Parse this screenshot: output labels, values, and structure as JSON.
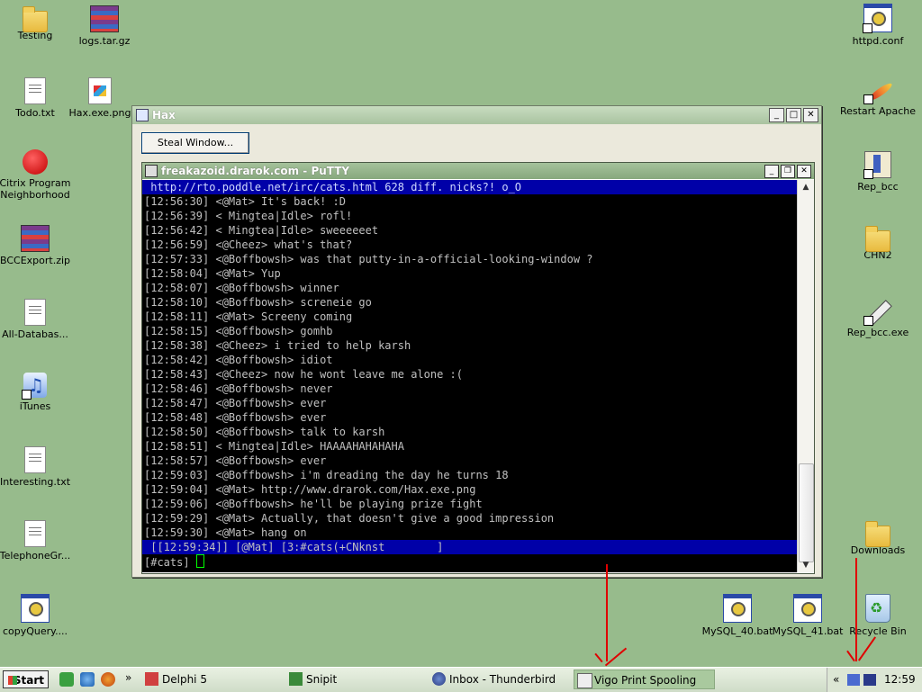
{
  "desktop": {
    "left_icons": [
      {
        "label": "Testing",
        "type": "folder"
      },
      {
        "label": "logs.tar.gz",
        "type": "rar"
      },
      {
        "label": "Todo.txt",
        "type": "doc"
      },
      {
        "label": "Hax.exe.png",
        "type": "png"
      },
      {
        "label": "Citrix Program Neighborhood",
        "type": "citrix"
      },
      {
        "label": "BCCExport.zip",
        "type": "rar"
      },
      {
        "label": "All-Databas...",
        "type": "doc"
      },
      {
        "label": "iTunes",
        "type": "itunes"
      },
      {
        "label": "Interesting.txt",
        "type": "doc"
      },
      {
        "label": "TelephoneGr...",
        "type": "doc"
      },
      {
        "label": "copyQuery....",
        "type": "win"
      }
    ],
    "right_icons": [
      {
        "label": "httpd.conf",
        "type": "win"
      },
      {
        "label": "Restart Apache",
        "type": "feather"
      },
      {
        "label": "Rep_bcc",
        "type": "bcc"
      },
      {
        "label": "CHN2",
        "type": "folder"
      },
      {
        "label": "Rep_bcc.exe",
        "type": "wrench"
      },
      {
        "label": "Downloads",
        "type": "folder"
      },
      {
        "label": "MySQL_40.bat",
        "type": "win"
      },
      {
        "label": "MySQL_41.bat",
        "type": "win"
      },
      {
        "label": "Recycle Bin",
        "type": "recycle"
      }
    ]
  },
  "hax_window": {
    "title": "Hax",
    "steal_button": "Steal Window..."
  },
  "putty": {
    "title": "freakazoid.drarok.com - PuTTY",
    "topic": " http://rto.poddle.net/irc/cats.html 628 diff. nicks?! o_O",
    "lines": [
      "[12:56:30] <@Mat> It's back! :D",
      "[12:56:39] < Mingtea|Idle> rofl!",
      "[12:56:42] < Mingtea|Idle> sweeeeeet",
      "[12:56:59] <@Cheez> what's that?",
      "[12:57:33] <@Boffbowsh> was that putty-in-a-official-looking-window ?",
      "[12:58:04] <@Mat> Yup",
      "[12:58:07] <@Boffbowsh> winner",
      "[12:58:10] <@Boffbowsh> screneie go",
      "[12:58:11] <@Mat> Screeny coming",
      "[12:58:15] <@Boffbowsh> gomhb",
      "[12:58:38] <@Cheez> i tried to help karsh",
      "[12:58:42] <@Boffbowsh> idiot",
      "[12:58:43] <@Cheez> now he wont leave me alone :(",
      "[12:58:46] <@Boffbowsh> never",
      "[12:58:47] <@Boffbowsh> ever",
      "[12:58:48] <@Boffbowsh> ever",
      "[12:58:50] <@Boffbowsh> talk to karsh",
      "[12:58:51] < Mingtea|Idle> HAAAAHAHAHAHA",
      "[12:58:57] <@Boffbowsh> ever",
      "[12:59:03] <@Boffbowsh> i'm dreading the day he turns 18",
      "[12:59:04] <@Mat> http://www.drarok.com/Hax.exe.png",
      "[12:59:06] <@Boffbowsh> he'll be playing prize fight",
      "[12:59:29] <@Mat> Actually, that doesn't give a good impression",
      "[12:59:30] <@Mat> hang on"
    ],
    "status": " [[12:59:34]] [@Mat] [3:#cats(+CNknst        ]",
    "prompt": "[#cats] "
  },
  "taskbar": {
    "start": "Start",
    "quicklaunch_more": "»",
    "tasks": [
      {
        "label": "Delphi 5",
        "active": false
      },
      {
        "label": "Snipit",
        "active": false
      },
      {
        "label": "Inbox - Thunderbird",
        "active": false
      },
      {
        "label": "Vigo Print Spooling",
        "active": true
      }
    ],
    "tray_chevron": "«",
    "clock": "12:59"
  },
  "colors": {
    "desktop": "#97bb8c",
    "annotation_arrows": "#e00000",
    "terminal_bg": "#000000",
    "terminal_bar": "#0000a8"
  }
}
